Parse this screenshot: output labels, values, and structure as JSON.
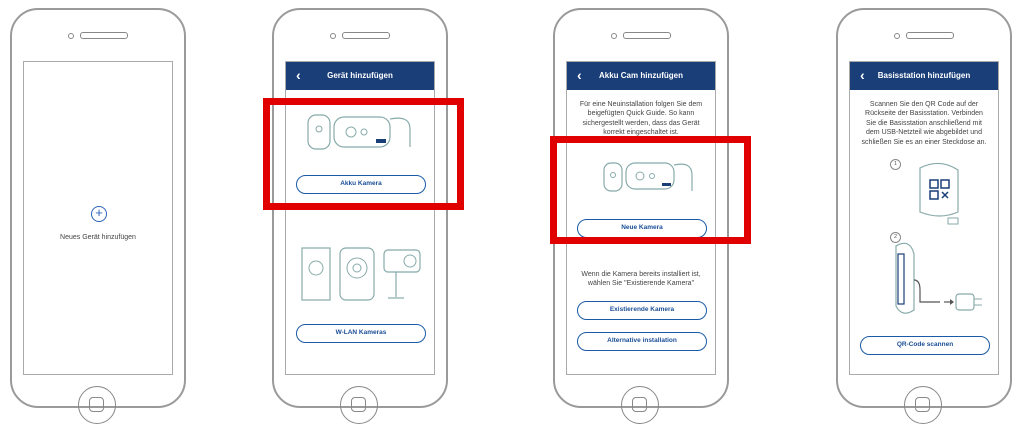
{
  "screen1": {
    "add_label": "Neues Gerät hinzufügen"
  },
  "screen2": {
    "title": "Gerät hinzufügen",
    "akku_button": "Akku Kamera",
    "wlan_button": "W-LAN Kameras"
  },
  "screen3": {
    "title": "Akku Cam hinzufügen",
    "description": "Für eine Neuinstallation folgen Sie dem beigefügten Quick Guide. So kann sichergestellt werden, dass das Gerät korrekt eingeschaltet ist.",
    "new_button": "Neue Kamera",
    "existing_text": "Wenn die Kamera bereits installiert ist, wählen Sie \"Existierende Kamera\"",
    "existing_button": "Existierende Kamera",
    "alt_button": "Alternative installation"
  },
  "screen4": {
    "title": "Basisstation hinzufügen",
    "description": "Scannen Sie den QR Code auf der Rückseite der Basisstation. Verbinden Sie die Basisstation anschließend mit dem USB-Netzteil wie abgebildet und schließen Sie es an einer Steckdose an.",
    "step1": "1",
    "step2": "2",
    "qr_button": "QR-Code scannen"
  },
  "colors": {
    "appbar": "#1a3e78",
    "button_border": "#1a5aa6",
    "highlight": "#e00000"
  }
}
